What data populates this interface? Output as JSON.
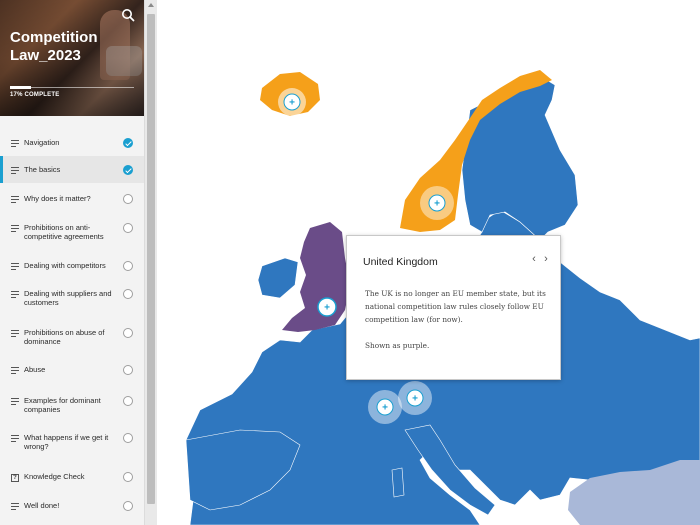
{
  "course": {
    "title": "Competition Law_2023",
    "progress_label": "17% COMPLETE",
    "progress_fraction": 0.17
  },
  "sidebar": {
    "items": [
      {
        "label": "Navigation",
        "status": "done",
        "icon": "lines-icon"
      },
      {
        "label": "The basics",
        "status": "done",
        "icon": "lines-icon",
        "active": true
      },
      {
        "label": "Why does it matter?",
        "status": "todo",
        "icon": "lines-icon"
      },
      {
        "label": "Prohibitions on anti-competitive agreements",
        "status": "todo",
        "icon": "lines-icon"
      },
      {
        "label": "Dealing with competitors",
        "status": "todo",
        "icon": "lines-icon"
      },
      {
        "label": "Dealing with suppliers and customers",
        "status": "todo",
        "icon": "lines-icon"
      },
      {
        "label": "Prohibitions on abuse of dominance",
        "status": "todo",
        "icon": "lines-icon"
      },
      {
        "label": "Abuse",
        "status": "todo",
        "icon": "lines-icon"
      },
      {
        "label": "Examples for dominant companies",
        "status": "todo",
        "icon": "lines-icon"
      },
      {
        "label": "What happens if we get it wrong?",
        "status": "todo",
        "icon": "lines-icon"
      },
      {
        "label": "Knowledge Check",
        "status": "todo",
        "icon": "question-icon"
      },
      {
        "label": "Well done!",
        "status": "todo",
        "icon": "lines-icon"
      }
    ]
  },
  "popup": {
    "title": "United Kingdom",
    "prev_glyph": "‹",
    "next_glyph": "›",
    "body1": "The UK is no longer an EU member state, but its national competition law rules closely follow EU competition law (for now).",
    "body2": "Shown as purple."
  },
  "map": {
    "colors": {
      "eu": "#2f77bf",
      "eea": "#f5a01a",
      "uk": "#6a4c88",
      "other": "#a9b8d8",
      "hotspot": "#1a9fd0"
    },
    "hotspot_glyph": "+"
  }
}
